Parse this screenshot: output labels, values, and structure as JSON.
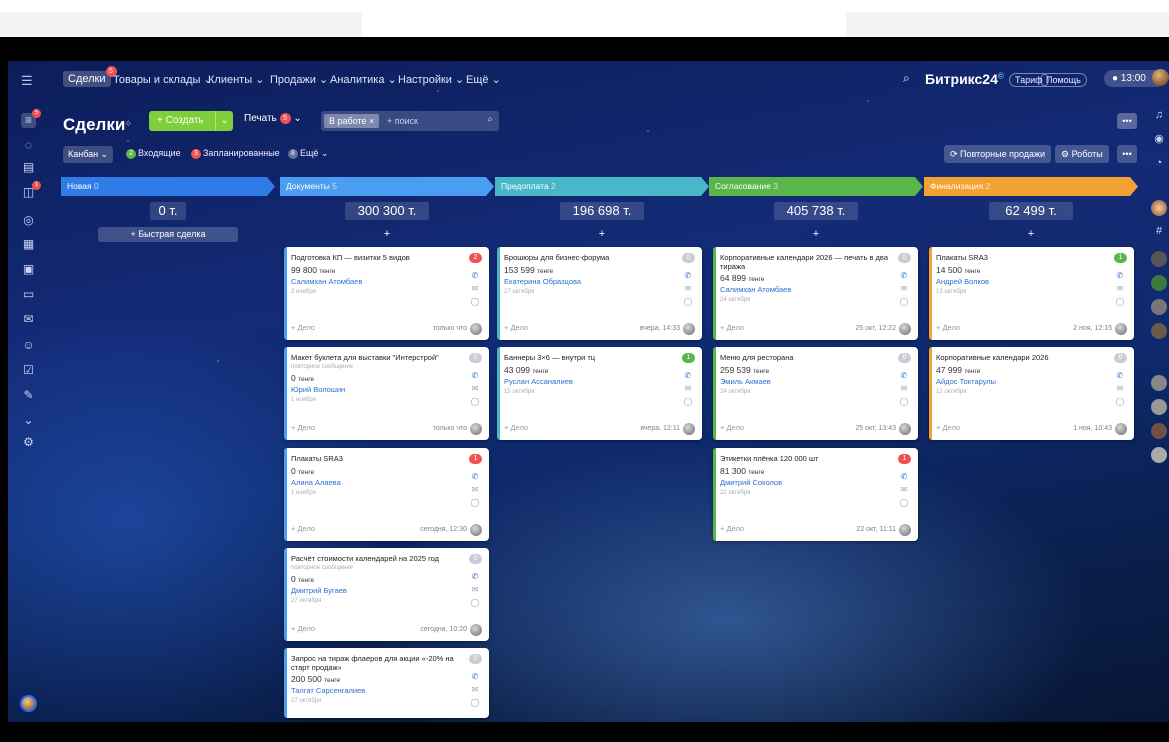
{
  "nav": {
    "items": [
      "Сделки",
      "Товары и склады",
      "Клиенты",
      "Продажи",
      "Аналитика",
      "Настройки",
      "Ещё"
    ],
    "deals_badge": "5",
    "logo": "Битрикс24",
    "tariff": "Тариф",
    "help": "Помощь",
    "time": "13:00"
  },
  "header": {
    "title": "Сделки",
    "create_label": "+ Создать",
    "print_label": "Печать",
    "print_badge": "5",
    "search_tag": "В работе",
    "search_placeholder": "+ поиск",
    "more": "•••"
  },
  "filters": {
    "kanban": "Канбан",
    "incoming": "Входящие",
    "incoming_count": "2",
    "planned": "Запланированные",
    "planned_count": "3",
    "more": "Ещё",
    "more_count": "8",
    "repeat_sales": "Повторные продажи",
    "robots": "Роботы",
    "extra": "•••"
  },
  "quick_deal": "+ Быстрая сделка",
  "add_plus": "+",
  "columns": [
    {
      "name": "Новая",
      "count": "0",
      "sum": "0 т.",
      "color": "#2f7be8"
    },
    {
      "name": "Документы",
      "count": "5",
      "sum": "300 300 т.",
      "color": "#4a9df0"
    },
    {
      "name": "Предоплата",
      "count": "2",
      "sum": "196 698 т.",
      "color": "#48b8c9"
    },
    {
      "name": "Согласование",
      "count": "3",
      "sum": "405 738 т.",
      "color": "#5ab648"
    },
    {
      "name": "Финализация",
      "count": "2",
      "sum": "62 499 т.",
      "color": "#f2a233"
    }
  ],
  "card_labels": {
    "delo": "+ Дело",
    "currency": "тенге"
  },
  "cards": [
    {
      "title": "Подготовка КП — визитки 5 видов",
      "note": "",
      "amount": "99 800",
      "contact": "Салимхан Атомбаев",
      "date": "2 ноября",
      "badge": "2",
      "badge_color": "#f25050",
      "time": "только что",
      "col": 1,
      "row": 0
    },
    {
      "title": "Макет буклета для выставки \"Интерстрой\"",
      "note": "повторное сообщение",
      "amount": "0",
      "contact": "Юрий Волошин",
      "date": "1 ноября",
      "badge": "0",
      "badge_color": "#c9cdd3",
      "time": "только что",
      "col": 1,
      "row": 1
    },
    {
      "title": "Плакаты SRA3",
      "note": "",
      "amount": "0",
      "contact": "Алина Алаева",
      "date": "1 ноября",
      "badge": "1",
      "badge_color": "#f25050",
      "time": "сегодня, 12:30",
      "col": 1,
      "row": 2
    },
    {
      "title": "Расчёт стоимости календарей на 2025 год",
      "note": "повторное сообщение",
      "amount": "0",
      "contact": "Дмитрий Бугаев",
      "date": "27 октября",
      "badge": "0",
      "badge_color": "#c9cdd3",
      "time": "сегодня, 10:20",
      "col": 1,
      "row": 3
    },
    {
      "title": "Запрос на тираж флаеров для акции «-20% на старт продаж»",
      "note": "",
      "amount": "200 500",
      "contact": "Талгат Сарсенгалиев",
      "date": "27 октября",
      "badge": "0",
      "badge_color": "#c9cdd3",
      "time": "",
      "col": 1,
      "row": 4
    },
    {
      "title": "Брошюры для бизнес-форума",
      "note": "",
      "amount": "153 599",
      "contact": "Екатерина Образцова",
      "date": "27 октября",
      "badge": "0",
      "badge_color": "#c9cdd3",
      "time": "вчера, 14:33",
      "col": 2,
      "row": 0
    },
    {
      "title": "Баннеры 3×6 — внутри тц",
      "note": "",
      "amount": "43 099",
      "contact": "Руслан Ассаналиев",
      "date": "15 октября",
      "badge": "1",
      "badge_color": "#5ab648",
      "time": "вчера, 12:11",
      "col": 2,
      "row": 1
    },
    {
      "title": "Корпоративные календари 2026 — печать в два тиража",
      "note": "",
      "amount": "64 899",
      "contact": "Салимхан Атомбаев",
      "date": "24 октября",
      "badge": "0",
      "badge_color": "#c9cdd3",
      "time": "25 окт, 12:22",
      "col": 3,
      "row": 0
    },
    {
      "title": "Меню для ресторана",
      "note": "",
      "amount": "259 539",
      "contact": "Эмиль Акмаев",
      "date": "24 октября",
      "badge": "0",
      "badge_color": "#c9cdd3",
      "time": "25 окт, 13:43",
      "col": 3,
      "row": 1
    },
    {
      "title": "Этикетки плёнка 120 000 шт",
      "note": "",
      "amount": "81 300",
      "contact": "Дмитрий Соколов",
      "date": "22 октября",
      "badge": "1",
      "badge_color": "#f25050",
      "time": "22 окт, 11:11",
      "col": 3,
      "row": 2
    },
    {
      "title": "Плакаты SRA3",
      "note": "",
      "amount": "14 500",
      "contact": "Андрей Волков",
      "date": "13 октября",
      "badge": "1",
      "badge_color": "#5ab648",
      "time": "2 ноя, 12:15",
      "col": 4,
      "row": 0
    },
    {
      "title": "Корпоративные календари 2026",
      "note": "",
      "amount": "47 999",
      "contact": "Айдос Токтарулы",
      "date": "12 октября",
      "badge": "0",
      "badge_color": "#c9cdd3",
      "time": "1 ноя, 10:43",
      "col": 4,
      "row": 1
    }
  ]
}
